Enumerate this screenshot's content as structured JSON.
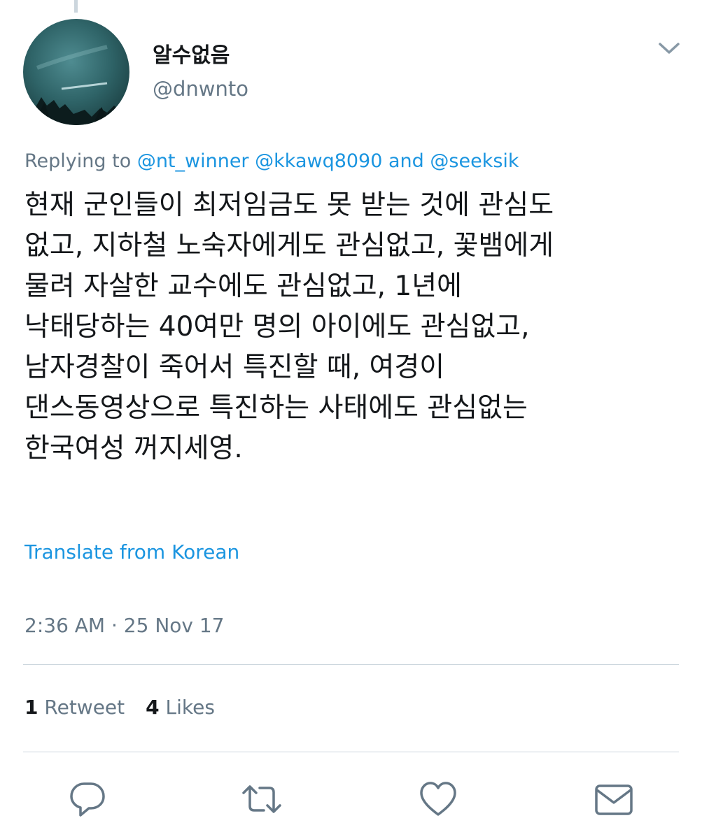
{
  "author": {
    "display_name": "알수없음",
    "handle": "@dnwnto"
  },
  "reply_context": {
    "prefix": "Replying to",
    "mentions": [
      "@nt_winner",
      "@kkawq8090",
      "@seeksik"
    ],
    "conjunction": "and"
  },
  "tweet": {
    "lines": [
      "현재 군인들이 최저임금도 못 받는 것에 관심도",
      "없고, 지하철 노숙자에게도 관심없고, 꽃뱀에게",
      "물려 자살한 교수에도 관심없고, 1년에",
      "낙태당하는 40여만 명의 아이에도 관심없고,",
      "남자경찰이 죽어서 특진할 때, 여경이",
      "댄스동영상으로 특진하는 사태에도 관심없는",
      "한국여성 꺼지세영."
    ],
    "translate_label": "Translate from Korean",
    "timestamp": "2:36 AM · 25 Nov 17"
  },
  "stats": {
    "retweet_count": "1",
    "retweet_label": "Retweet",
    "like_count": "4",
    "like_label": "Likes"
  },
  "icons": {
    "menu": "chevron-down-icon",
    "reply": "reply-icon",
    "retweet": "retweet-icon",
    "like": "heart-icon",
    "dm": "envelope-icon"
  },
  "colors": {
    "link": "#1b95e0",
    "secondary_text": "#657786",
    "primary_text": "#14171a",
    "divider": "#ccd6dd"
  }
}
